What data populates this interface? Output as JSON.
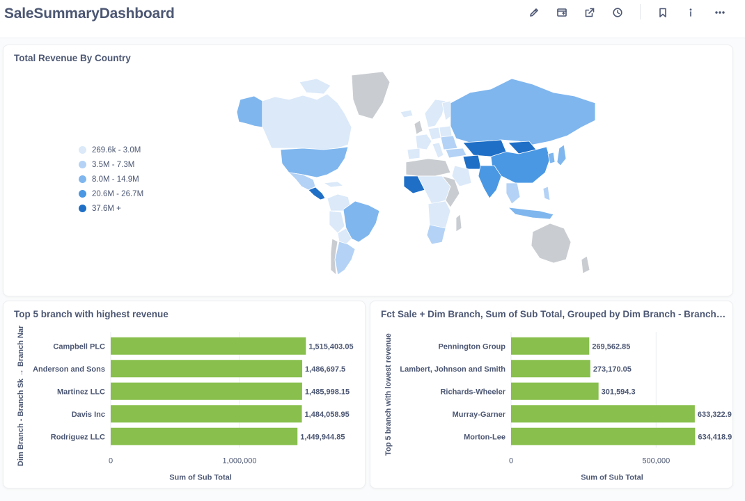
{
  "dashboard": {
    "title": "SaleSummaryDashboard",
    "toolbar": [
      "pencil-icon",
      "subscribe-icon",
      "share-icon",
      "history-icon",
      "bookmark-icon",
      "info-icon",
      "more-icon"
    ]
  },
  "map_card": {
    "title": "Total Revenue By Country",
    "legend": [
      {
        "label": "269.6k - 3.0M",
        "color": "#dbe9f9"
      },
      {
        "label": "3.5M - 7.3M",
        "color": "#b3d2f5"
      },
      {
        "label": "8.0M - 14.9M",
        "color": "#7fb6ee"
      },
      {
        "label": "20.6M - 26.7M",
        "color": "#4a98e4"
      },
      {
        "label": "37.6M +",
        "color": "#1f6fc7"
      }
    ],
    "no_data_color": "#c9cdd1"
  },
  "bar_color": "#88bf4d",
  "chart_data": [
    {
      "type": "bar",
      "orientation": "horizontal",
      "title": "Top 5 branch with highest revenue",
      "xlabel": "Sum of Sub Total",
      "ylabel": "Dim Branch - Branch Sk → Branch Nar",
      "categories": [
        "Campbell PLC",
        "Anderson and Sons",
        "Martinez LLC",
        "Davis Inc",
        "Rodriguez LLC"
      ],
      "values": [
        1515403.05,
        1486697.5,
        1485998.15,
        1484058.95,
        1449944.85
      ],
      "value_labels": [
        "1,515,403.05",
        "1,486,697.5",
        "1,485,998.15",
        "1,484,058.95",
        "1,449,944.85"
      ],
      "xticks": [
        {
          "value": 0,
          "label": "0"
        },
        {
          "value": 1000000,
          "label": "1,000,000"
        }
      ],
      "xlim": [
        0,
        2000000
      ]
    },
    {
      "type": "bar",
      "orientation": "horizontal",
      "title": "Fct Sale + Dim Branch, Sum of Sub Total, Grouped by Dim Branch - Branch…",
      "xlabel": "Sum of Sub Total",
      "ylabel": "Top 5 branch with lowest revenue",
      "categories": [
        "Pennington Group",
        "Lambert, Johnson and Smith",
        "Richards-Wheeler",
        "Murray-Garner",
        "Morton-Lee"
      ],
      "values": [
        269562.85,
        273170.05,
        301594.3,
        633322.9,
        634418.9
      ],
      "value_labels": [
        "269,562.85",
        "273,170.05",
        "301,594.3",
        "633,322.9",
        "634,418.9"
      ],
      "xticks": [
        {
          "value": 0,
          "label": "0"
        },
        {
          "value": 500000,
          "label": "500,000"
        }
      ],
      "xlim": [
        0,
        720000
      ]
    }
  ]
}
